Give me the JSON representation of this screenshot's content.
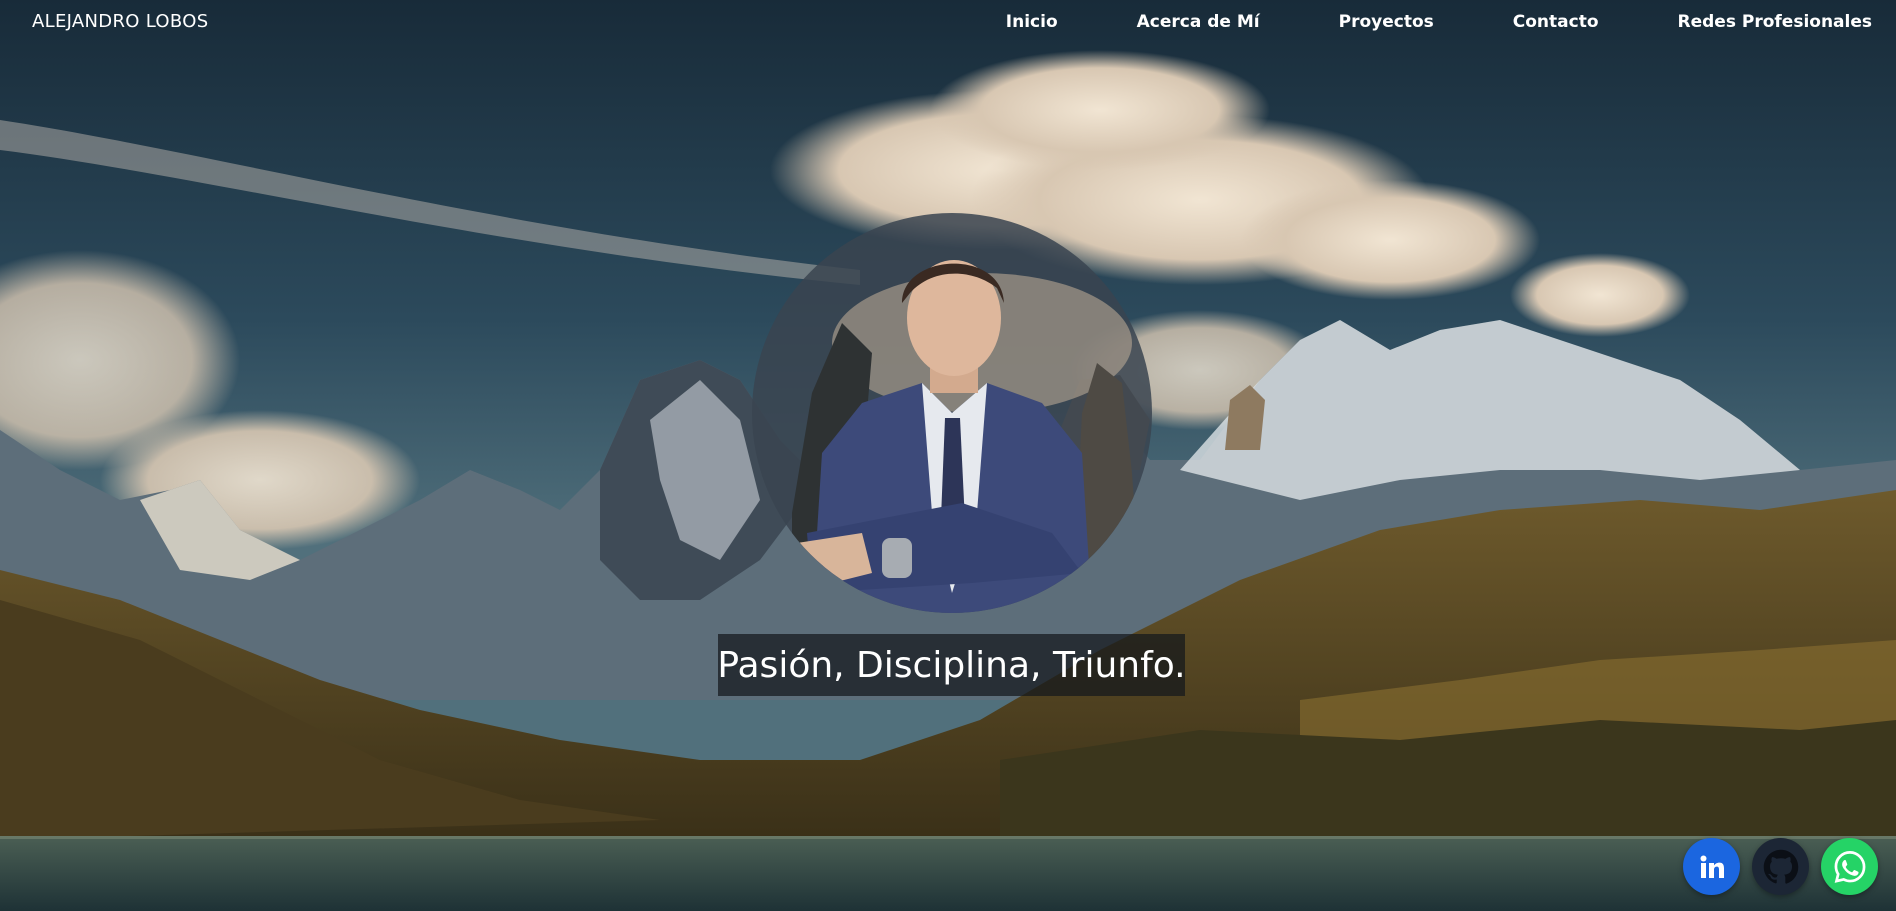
{
  "header": {
    "brand": "ALEJANDRO LOBOS"
  },
  "nav": {
    "items": [
      {
        "label": "Inicio"
      },
      {
        "label": "Acerca de Mí"
      },
      {
        "label": "Proyectos"
      },
      {
        "label": "Contacto"
      },
      {
        "label": "Redes Profesionales"
      }
    ]
  },
  "hero": {
    "background": "mountain-landscape-photo",
    "portrait": "profile-photo",
    "tagline": "Pasión, Disciplina, Triunfo."
  },
  "social": {
    "buttons": [
      {
        "icon": "linkedin-icon",
        "color": "#1b66e0"
      },
      {
        "icon": "github-icon",
        "color": "#1c2635"
      },
      {
        "icon": "whatsapp-icon",
        "color": "#25d366"
      }
    ]
  },
  "colors": {
    "sky_top": "#1a3040",
    "sky_mid": "#35586a",
    "water": "#2f4a4d"
  }
}
